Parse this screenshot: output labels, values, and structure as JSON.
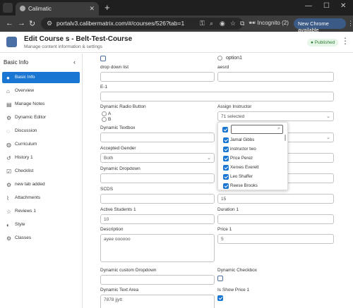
{
  "browser": {
    "tab_title": "Calimatic",
    "url": "portalv3.calibermatrix.com/#/courses/526?tab=1",
    "profile": "Incognito (2)",
    "update_label": "New Chrome available"
  },
  "header": {
    "title": "Edit Course s - Belt-Test-Course",
    "subtitle": "Manage content information & settings",
    "status": "Published"
  },
  "sidebar": {
    "title": "Basic Info",
    "items": [
      {
        "label": "Basic Info",
        "icon": "info-icon"
      },
      {
        "label": "Overview",
        "icon": "home-icon"
      },
      {
        "label": "Manage Notes",
        "icon": "notes-icon"
      },
      {
        "label": "Dynamic Editor",
        "icon": "gear-icon"
      },
      {
        "label": "Discussion",
        "icon": "chat-icon"
      },
      {
        "label": "Curriculum",
        "icon": "globe-icon"
      },
      {
        "label": "History 1",
        "icon": "history-icon"
      },
      {
        "label": "Checklist",
        "icon": "checklist-icon"
      },
      {
        "label": "new tab added",
        "icon": "gear-icon"
      },
      {
        "label": "Attachments",
        "icon": "paperclip-icon"
      },
      {
        "label": "Reviews 1",
        "icon": "star-icon"
      },
      {
        "label": "Style",
        "icon": "palette-icon"
      },
      {
        "label": "Classes",
        "icon": "gear-icon"
      }
    ]
  },
  "form": {
    "option1_label": "option1",
    "drop_down_list_label": "drop down list",
    "aesrd_label": "aesrd",
    "e1_label": "E-1",
    "dynamic_radio_label": "Dynamic Radio Button",
    "radio_a": "A",
    "radio_b": "B",
    "assign_instructor_label": "Assign Instructor",
    "assign_instructor_value": "71 selected",
    "dynamic_textbox_label": "Dynamic Textbox",
    "accepted_gender_label": "Accepted Gender",
    "accepted_gender_value": "Both",
    "dynamic_dropdown_label": "Dynamic Dropdown",
    "scds_label": "SCDS",
    "right_scds_value": "15",
    "active_students_label": "Active Students 1",
    "active_students_value": "10",
    "duration_label": "Duration 1",
    "description_label": "Description",
    "description_value": "ayee oooooo",
    "price_label": "Price 1",
    "price_value": "5",
    "custom_dropdown_label": "Dynamic custom Dropdown",
    "dynamic_checkbox_label": "Dynamic Checkbox",
    "text_area_label": "Dynamic Text Area",
    "text_area_value": "7878 jjytt",
    "show_price_label": "Is Show Price 1"
  },
  "instructor_dropdown": {
    "search_value": "",
    "options": [
      "Jamal Gibbs",
      "instructor two",
      "Price Perez",
      "Xerxes Everett",
      "Leo Shaffer",
      "Reese Brooks"
    ]
  },
  "colors": {
    "accent": "#1976d2",
    "published_bg": "#e6f6e8",
    "published_text": "#2e7d32"
  }
}
